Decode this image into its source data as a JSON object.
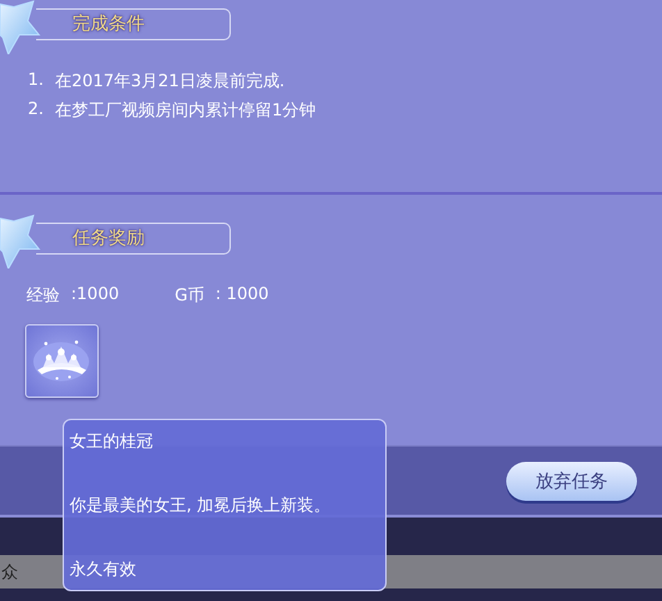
{
  "conditions": {
    "title": "完成条件",
    "items": [
      {
        "number": "1.",
        "text": "在2017年3月21日凌晨前完成."
      },
      {
        "number": "2.",
        "text": "在梦工厂视频房间内累计停留1分钟"
      }
    ]
  },
  "rewards": {
    "title": "任务奖励",
    "values": [
      {
        "label": "经验",
        "value": ":1000"
      },
      {
        "label": "G币",
        "value": ": 1000"
      }
    ]
  },
  "tooltip": {
    "name": "女王的桂冠",
    "description": "你是最美的女王, 加冕后换上新装。",
    "duration": "永久有效"
  },
  "abandon_button": "放弃任务",
  "bottom_bar": {
    "text": "众"
  }
}
